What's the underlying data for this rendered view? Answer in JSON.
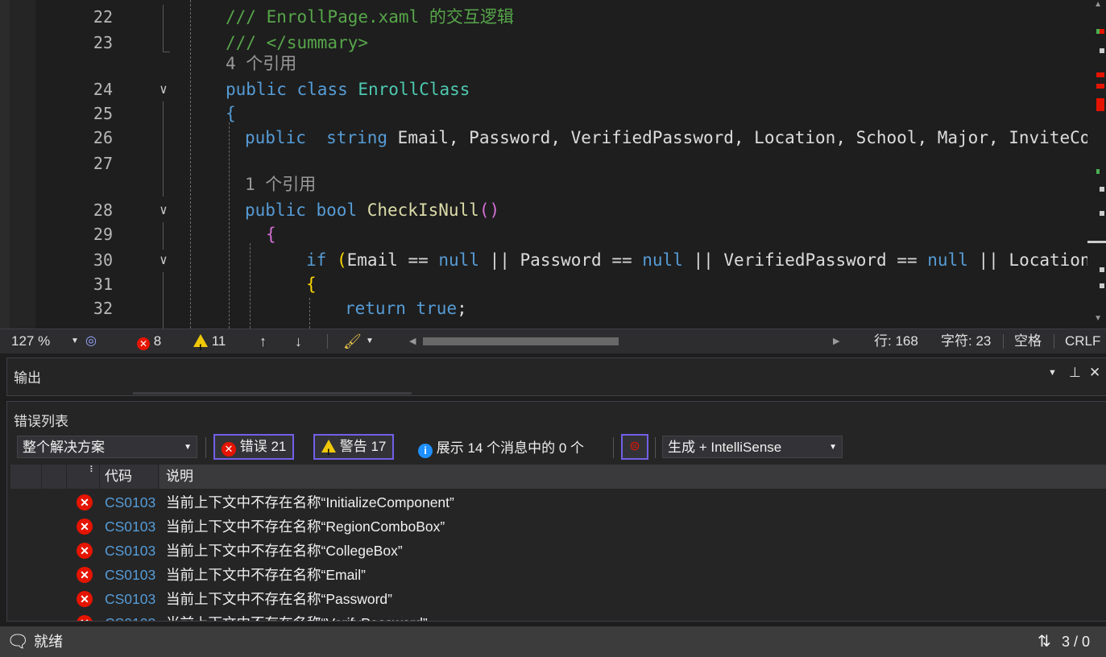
{
  "editor": {
    "lines": [
      {
        "num": "22",
        "segments": [
          {
            "t": "/// EnrollPage.xaml 的交互逻辑",
            "c": "c-comment"
          }
        ]
      },
      {
        "num": "23",
        "segments": [
          {
            "t": "/// </summary>",
            "c": "c-comment"
          }
        ]
      },
      {
        "num": "",
        "segments": [
          {
            "t": "4 个引用",
            "c": "c-lens"
          }
        ]
      },
      {
        "num": "24",
        "segments": [
          {
            "t": "public ",
            "c": "c-kw"
          },
          {
            "t": "class ",
            "c": "c-kw"
          },
          {
            "t": "EnrollClass",
            "c": "c-type"
          }
        ]
      },
      {
        "num": "25",
        "segments": [
          {
            "t": "{",
            "c": "c-kw"
          }
        ]
      },
      {
        "num": "26",
        "segments": [
          {
            "t": "public  ",
            "c": "c-kw"
          },
          {
            "t": "string ",
            "c": "c-kw"
          },
          {
            "t": "Email, Password, VerifiedPassword, Location, School, Major, InviteCode;",
            "c": "c-id"
          }
        ]
      },
      {
        "num": "27",
        "segments": []
      },
      {
        "num": "",
        "segments": [
          {
            "t": "1 个引用",
            "c": "c-lens"
          }
        ]
      },
      {
        "num": "28",
        "segments": [
          {
            "t": "public ",
            "c": "c-kw"
          },
          {
            "t": "bool ",
            "c": "c-kw"
          },
          {
            "t": "CheckIsNull",
            "c": "c-method"
          },
          {
            "t": "()",
            "c": "c-purple"
          }
        ]
      },
      {
        "num": "29",
        "segments": [
          {
            "t": "{",
            "c": "c-purple"
          }
        ]
      },
      {
        "num": "30",
        "segments": [
          {
            "t": "if ",
            "c": "c-kw"
          },
          {
            "t": "(",
            "c": "c-yellow"
          },
          {
            "t": "Email == ",
            "c": "c-id"
          },
          {
            "t": "null",
            "c": "c-kw"
          },
          {
            "t": " || Password == ",
            "c": "c-id"
          },
          {
            "t": "null",
            "c": "c-kw"
          },
          {
            "t": " || VerifiedPassword == ",
            "c": "c-id"
          },
          {
            "t": "null",
            "c": "c-kw"
          },
          {
            "t": " || Location == ",
            "c": "c-id"
          }
        ]
      },
      {
        "num": "31",
        "segments": [
          {
            "t": "{",
            "c": "c-yellow"
          }
        ]
      },
      {
        "num": "32",
        "segments": [
          {
            "t": "return ",
            "c": "c-kw"
          },
          {
            "t": "true",
            "c": "c-kw"
          },
          {
            "t": ";",
            "c": "c-id"
          }
        ]
      }
    ]
  },
  "editor_status": {
    "zoom": "127 %",
    "errors": "8",
    "warnings": "11",
    "line": "行: 168",
    "char": "字符: 23",
    "spaces": "空格",
    "eol": "CRLF"
  },
  "output": {
    "title": "输出"
  },
  "error_list": {
    "title": "错误列表",
    "scope": "整个解决方案",
    "errors_btn": "错误 21",
    "warnings_btn": "警告 17",
    "messages_text": "展示 14 个消息中的 0 个",
    "build_filter": "生成 + IntelliSense",
    "col_code": "代码",
    "col_desc": "说明",
    "rows": [
      {
        "code": "CS0103",
        "desc": "当前上下文中不存在名称“InitializeComponent”"
      },
      {
        "code": "CS0103",
        "desc": "当前上下文中不存在名称“RegionComboBox”"
      },
      {
        "code": "CS0103",
        "desc": "当前上下文中不存在名称“CollegeBox”"
      },
      {
        "code": "CS0103",
        "desc": "当前上下文中不存在名称“Email”"
      },
      {
        "code": "CS0103",
        "desc": "当前上下文中不存在名称“Password”"
      },
      {
        "code": "CS0103",
        "desc": "当前上下文中不存在名称“VerifyPassword”"
      }
    ]
  },
  "status_bar": {
    "state": "就绪",
    "counter": "3 / 0"
  },
  "colors": {
    "accent": "#7160e8",
    "error": "#e51400",
    "warning": "#f0c808",
    "info": "#1e90ff"
  }
}
